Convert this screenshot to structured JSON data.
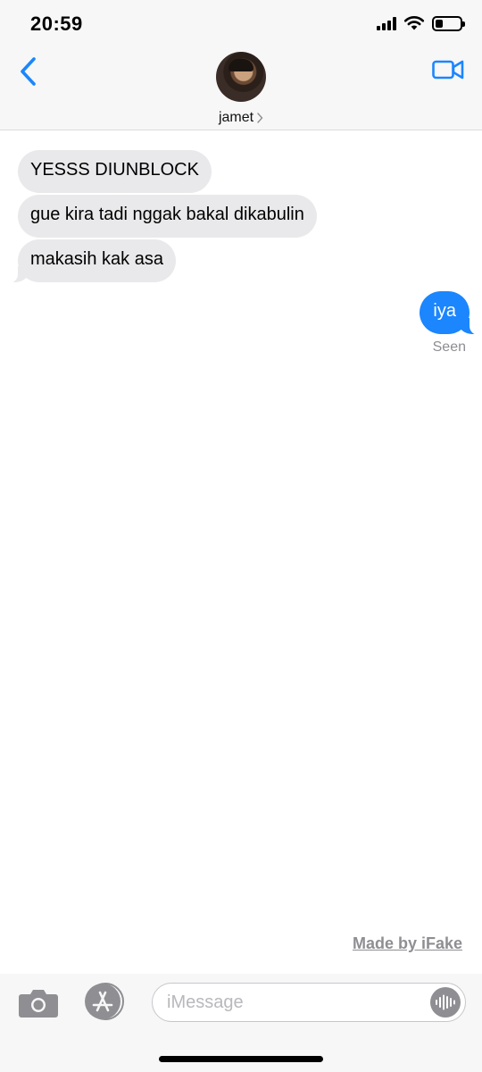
{
  "status_bar": {
    "time": "20:59",
    "icons": [
      "signal-icon",
      "wifi-icon",
      "battery-icon"
    ],
    "battery_level": 0.3
  },
  "header": {
    "contact_name": "jamet",
    "back_icon": "chevron-left-icon",
    "video_icon": "video-camera-icon",
    "accent_color": "#1b86fd"
  },
  "messages": [
    {
      "direction": "incoming",
      "text": "YESSS DIUNBLOCK"
    },
    {
      "direction": "incoming",
      "text": "gue kira tadi nggak bakal dikabulin"
    },
    {
      "direction": "incoming",
      "text": "makasih kak asa"
    },
    {
      "direction": "outgoing",
      "text": "iya"
    }
  ],
  "receipt": "Seen",
  "watermark": "Made by iFake",
  "composer": {
    "placeholder": "iMessage",
    "camera_icon": "camera-icon",
    "apps_icon": "app-store-icon",
    "audio_icon": "audio-waveform-icon"
  },
  "colors": {
    "incoming_bubble": "#e9e9eb",
    "outgoing_bubble": "#1b86fd"
  }
}
